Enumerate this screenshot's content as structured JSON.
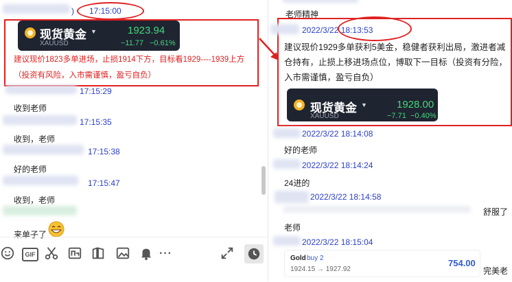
{
  "left": {
    "top_time": "17:15:00",
    "quote": {
      "name": "现货黄金",
      "symbol": "XAUUSD",
      "price": "1923.94",
      "change": "−11.77",
      "change_pct": "−0.61%"
    },
    "annotation": "建议现价1823多单进场，止损1914下方，目标看1929----1939上方（投资有风险，入市需谨慎，盈亏自负）",
    "messages": [
      {
        "time": "17:15:29",
        "text": "收到老师"
      },
      {
        "time": "17:15:35",
        "text": "收到，老师"
      },
      {
        "time": "17:15:38",
        "text": "好的老师"
      },
      {
        "time": "17:15:47",
        "text": "收到，老师"
      },
      {
        "text": "来单子了",
        "emoji": "grin"
      }
    ],
    "time_prefix_char": ")"
  },
  "toolbar": {
    "icons": [
      "emoji-icon",
      "gif-icon",
      "scissors-icon",
      "snippet-icon",
      "image-icon",
      "bell-icon",
      "more-icon",
      "expand-icon",
      "history-icon"
    ],
    "gif_label": "GIF",
    "more_label": "···"
  },
  "right": {
    "header_partial": "老师精神",
    "main_time": "2022/3/22 18:13:53",
    "main_text": "建议现价1929多单获利5美金，稳健者获利出局，激进者减仓持有，止损上移进场点位，博取下一目标（投资有分险，入市需谨慎，盈亏自负）",
    "quote": {
      "name": "现货黄金",
      "symbol": "XAUUSD",
      "price": "1928.00",
      "change": "−7.71",
      "change_pct": "−0.40%"
    },
    "messages": [
      {
        "time": "2022/3/22 18:14:08",
        "text": "好的老师"
      },
      {
        "time": "2022/3/22 18:14:24",
        "text": "24进的"
      },
      {
        "time": "2022/3/22 18:14:58",
        "text": "舒服了"
      },
      {
        "text": "老师"
      },
      {
        "time": "2022/3/22 18:15:04"
      }
    ],
    "trade_card": {
      "title": "Gold",
      "side": "buy 2",
      "range": "1924.15 → 1927.92",
      "profit": "754.00"
    },
    "tail_text": "完美老"
  },
  "colors": {
    "annotation_red": "#e02020",
    "timestamp_blue": "#2a3ec7",
    "quote_bg": "#1f2431",
    "quote_green": "#44d87a",
    "trade_blue": "#2f5bd4"
  }
}
